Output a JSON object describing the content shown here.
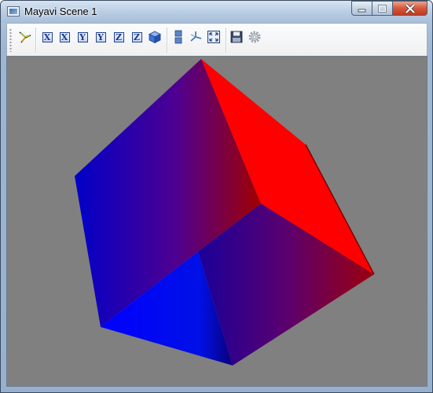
{
  "window": {
    "title": "Mayavi Scene 1",
    "buttons": [
      "minimize",
      "maximize",
      "close"
    ]
  },
  "toolbar": {
    "buttons": [
      {
        "icon": "mayavi-logo-icon"
      },
      {
        "icon": "view-x-minus-icon",
        "glyph": "X"
      },
      {
        "icon": "view-x-plus-icon",
        "glyph": "X"
      },
      {
        "icon": "view-y-minus-icon",
        "glyph": "Y"
      },
      {
        "icon": "view-y-plus-icon",
        "glyph": "Y"
      },
      {
        "icon": "view-z-minus-icon",
        "glyph": "Z"
      },
      {
        "icon": "view-z-plus-icon",
        "glyph": "Z"
      },
      {
        "icon": "isometric-view-icon"
      },
      {
        "icon": "toggle-parallel-projection-icon"
      },
      {
        "icon": "toggle-axes-indicator-icon"
      },
      {
        "icon": "full-screen-icon"
      },
      {
        "icon": "save-scene-icon"
      },
      {
        "icon": "configure-scene-icon"
      }
    ]
  },
  "scene": {
    "background": "#808080",
    "object": "cube",
    "colors": {
      "red": "#ff0000",
      "blue": "#0000ff",
      "dark_red": "#8b0000"
    }
  }
}
